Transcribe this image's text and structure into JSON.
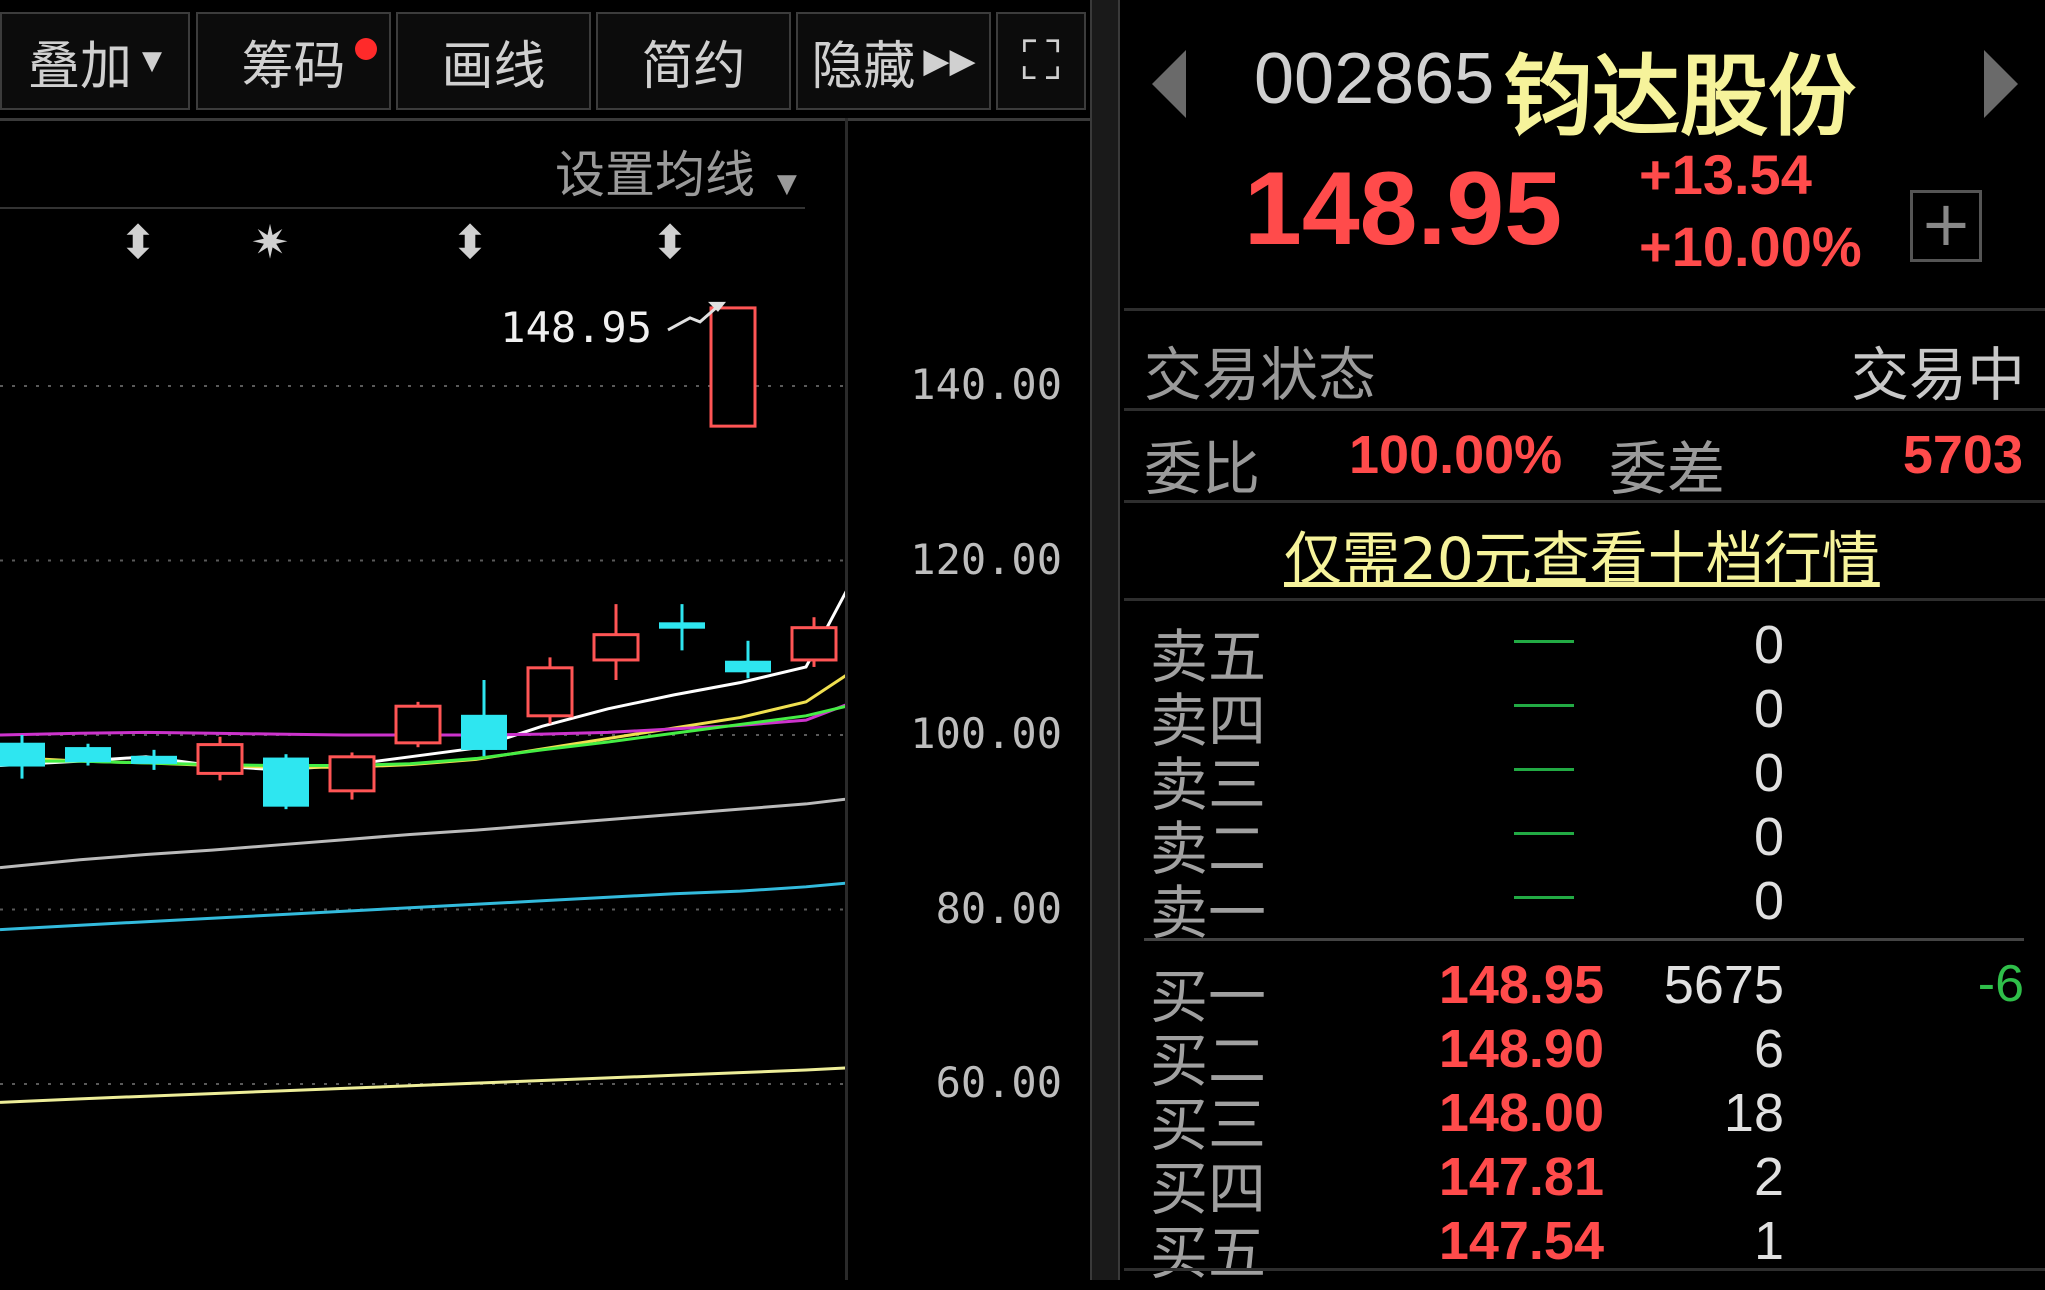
{
  "toolbar": {
    "overlay": "叠加",
    "chips": "筹码",
    "draw": "画线",
    "simple": "简约",
    "hide": "隐藏",
    "hide_glyph": "▶▶",
    "fullscreen_glyph": "⛶"
  },
  "chart": {
    "ma_settings": "设置均线",
    "last_price_label": "148.95",
    "marker_glyphs": [
      "⬍",
      "✷",
      "⬍",
      "⬍"
    ],
    "y_ticks": [
      "140.00",
      "120.00",
      "100.00",
      "80.00",
      "60.00"
    ],
    "colors": {
      "up": "#ff5555",
      "down": "#2ee6f0",
      "ma5": "#ffffff",
      "ma10": "#f0e050",
      "ma20": "#cc33cc",
      "ma30": "#44ee44",
      "ma60": "#bbbbbb",
      "ma120": "#33bbdd",
      "ma250": "#eeee99"
    }
  },
  "chart_data": {
    "type": "candlestick",
    "y_ticks": [
      140,
      120,
      100,
      80,
      60
    ],
    "ylim": [
      56,
      160
    ],
    "last_price": 148.95,
    "candles": [
      {
        "open": 99.0,
        "close": 96.5,
        "high": 100.0,
        "low": 95.0
      },
      {
        "open": 98.5,
        "close": 97.0,
        "high": 99.0,
        "low": 96.5
      },
      {
        "open": 97.5,
        "close": 96.8,
        "high": 98.3,
        "low": 96.0
      },
      {
        "open": 95.6,
        "close": 98.9,
        "high": 99.8,
        "low": 94.8
      },
      {
        "open": 97.3,
        "close": 91.9,
        "high": 97.8,
        "low": 91.5
      },
      {
        "open": 93.6,
        "close": 97.5,
        "high": 98.0,
        "low": 92.6
      },
      {
        "open": 99.1,
        "close": 103.3,
        "high": 103.8,
        "low": 98.6
      },
      {
        "open": 102.2,
        "close": 98.4,
        "high": 106.3,
        "low": 97.6
      },
      {
        "open": 102.2,
        "close": 107.7,
        "high": 108.9,
        "low": 101.3
      },
      {
        "open": 108.6,
        "close": 111.5,
        "high": 115.0,
        "low": 106.3
      },
      {
        "open": 112.8,
        "close": 112.3,
        "high": 115.0,
        "low": 109.7
      },
      {
        "open": 108.4,
        "close": 107.3,
        "high": 110.8,
        "low": 106.5
      },
      {
        "open": 108.6,
        "close": 112.3,
        "high": 113.5,
        "low": 107.8
      },
      {
        "open": 135.4,
        "close": 148.95,
        "high": 148.95,
        "low": 135.4
      }
    ],
    "ma_lines": [
      {
        "color": "#ffffff",
        "values": [
          96.5,
          97.0,
          97.5,
          96.5,
          96.0,
          96.5,
          97.5,
          98.5,
          101.0,
          103.0,
          104.6,
          106.0,
          107.8,
          122.0
        ]
      },
      {
        "color": "#f0e050",
        "values": [
          97.5,
          97.0,
          96.8,
          96.5,
          96.3,
          96.3,
          96.6,
          97.2,
          98.4,
          99.6,
          100.8,
          102.0,
          103.8,
          108.8
        ]
      },
      {
        "color": "#cc33cc",
        "values": [
          100.0,
          100.2,
          100.3,
          100.2,
          100.1,
          100.0,
          100.0,
          100.0,
          100.1,
          100.3,
          100.7,
          101.1,
          101.7,
          104.6
        ]
      },
      {
        "color": "#44ee44",
        "values": [
          97.0,
          97.0,
          96.8,
          96.6,
          96.5,
          96.5,
          96.7,
          97.3,
          98.3,
          99.2,
          100.2,
          101.2,
          102.2,
          104.0
        ]
      },
      {
        "color": "#bbbbbb",
        "values": [
          84.8,
          85.7,
          86.3,
          86.8,
          87.4,
          88.0,
          88.6,
          89.1,
          89.7,
          90.3,
          90.9,
          91.5,
          92.1,
          93.0
        ]
      },
      {
        "color": "#33bbdd",
        "values": [
          77.7,
          78.2,
          78.6,
          79.0,
          79.4,
          79.8,
          80.2,
          80.6,
          81.0,
          81.4,
          81.8,
          82.1,
          82.6,
          83.3
        ]
      },
      {
        "color": "#eeee99",
        "values": [
          57.9,
          58.3,
          58.6,
          58.9,
          59.2,
          59.5,
          59.8,
          60.1,
          60.4,
          60.7,
          61.0,
          61.3,
          61.6,
          62.0
        ]
      }
    ]
  },
  "panel": {
    "code": "002865",
    "name": "钧达股份",
    "price": "148.95",
    "change": "+13.54",
    "change_pct": "+10.00%",
    "add_glyph": "+",
    "status_label": "交易状态",
    "status_value": "交易中",
    "ratio_label": "委比",
    "ratio_value": "100.00%",
    "diff_label": "委差",
    "diff_value": "5703",
    "promo": "仅需20元查看十档行情",
    "sell": [
      {
        "label": "卖五",
        "vol": "0"
      },
      {
        "label": "卖四",
        "vol": "0"
      },
      {
        "label": "卖三",
        "vol": "0"
      },
      {
        "label": "卖二",
        "vol": "0"
      },
      {
        "label": "卖一",
        "vol": "0"
      }
    ],
    "buy": [
      {
        "label": "买一",
        "price": "148.95",
        "vol": "5675",
        "chg": "-6"
      },
      {
        "label": "买二",
        "price": "148.90",
        "vol": "6",
        "chg": ""
      },
      {
        "label": "买三",
        "price": "148.00",
        "vol": "18",
        "chg": ""
      },
      {
        "label": "买四",
        "price": "147.81",
        "vol": "2",
        "chg": ""
      },
      {
        "label": "买五",
        "price": "147.54",
        "vol": "1",
        "chg": ""
      }
    ]
  }
}
